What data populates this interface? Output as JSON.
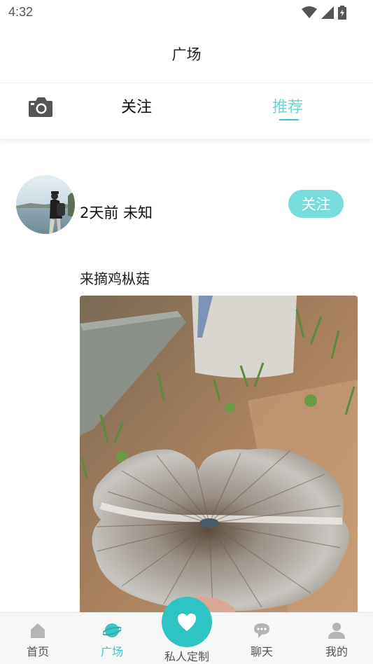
{
  "status_bar": {
    "time": "4:32"
  },
  "header": {
    "title": "广场"
  },
  "tabs": {
    "follow": "关注",
    "recommend": "推荐"
  },
  "post": {
    "meta": "2天前 未知",
    "follow_button": "关注",
    "text": "来摘鸡枞菇"
  },
  "bottom_nav": {
    "home": "首页",
    "plaza": "广场",
    "custom": "私人定制",
    "chat": "聊天",
    "mine": "我的"
  },
  "colors": {
    "accent": "#3cc7c7",
    "follow_button": "#77dcdc",
    "tab_active": "#6fd3d3"
  },
  "icons": [
    "camera-icon",
    "wifi-icon",
    "signal-icon",
    "battery-icon",
    "home-icon",
    "planet-icon",
    "heart-icon",
    "chat-icon",
    "user-icon"
  ]
}
